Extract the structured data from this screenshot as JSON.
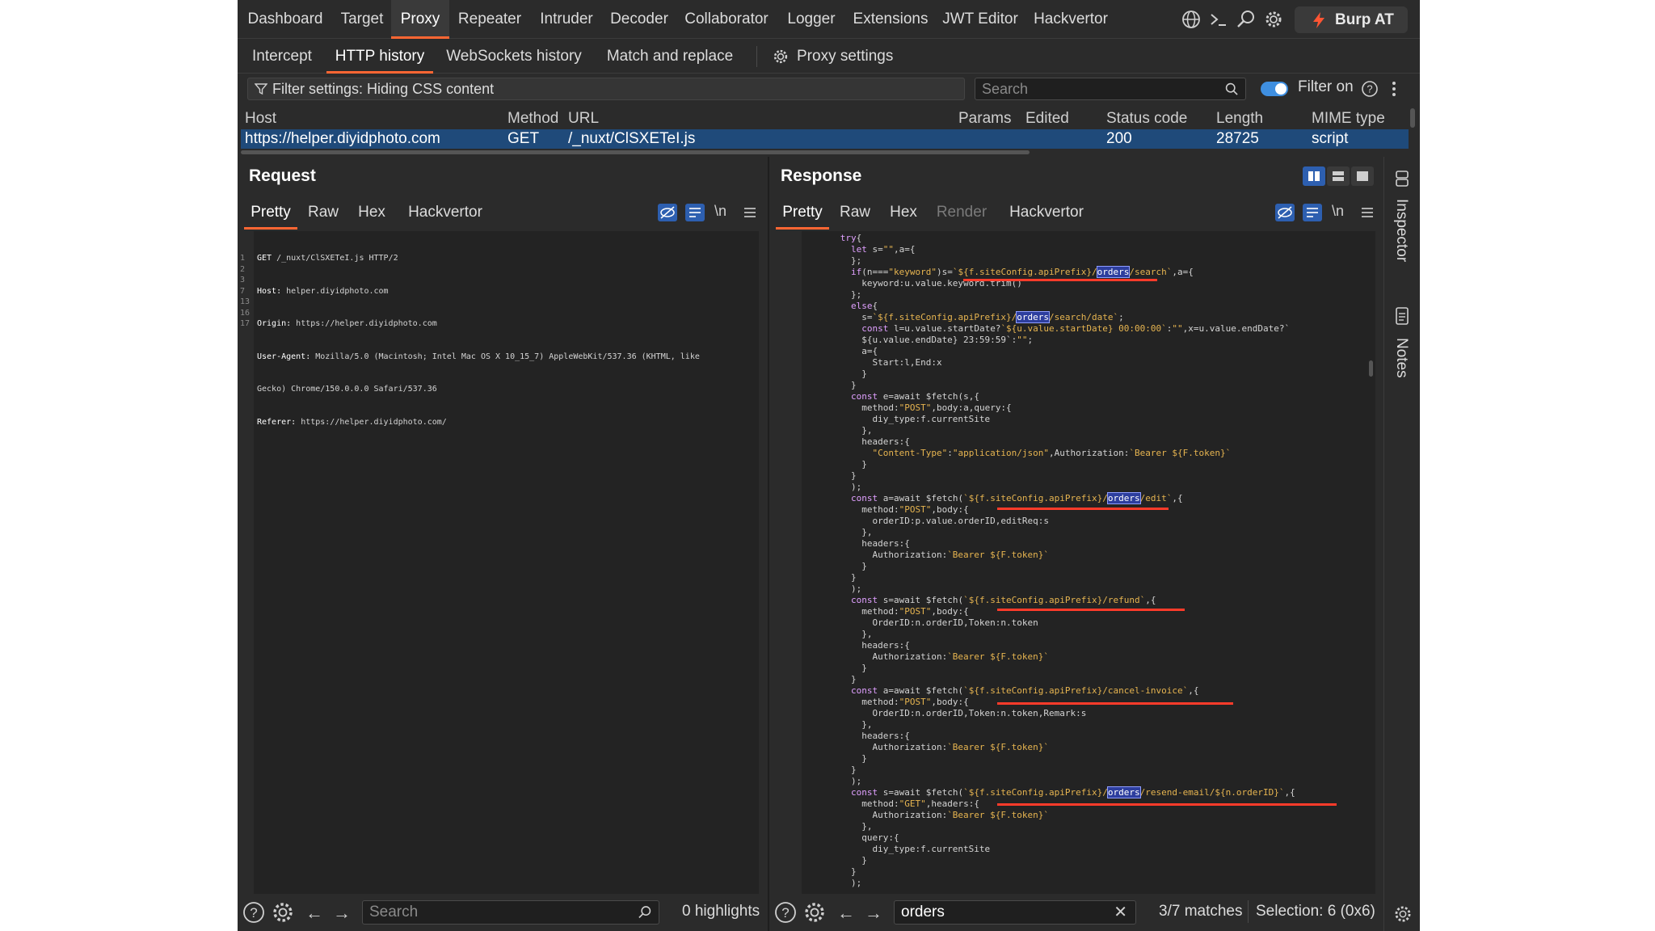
{
  "top_nav": {
    "tabs": [
      "Dashboard",
      "Target",
      "Proxy",
      "Repeater",
      "Intruder",
      "Decoder",
      "Collaborator",
      "Logger",
      "Extensions",
      "JWT Editor",
      "Hackvertor"
    ],
    "active": "Proxy",
    "burp_button": "Burp AT",
    "icons": [
      "globe-icon",
      "terminal-icon",
      "search-icon",
      "gear-icon"
    ]
  },
  "sub_nav": {
    "tabs": [
      "Intercept",
      "HTTP history",
      "WebSockets history",
      "Match and replace"
    ],
    "active": "HTTP history",
    "settings": "Proxy settings"
  },
  "filter": {
    "label": "Filter settings: Hiding CSS content",
    "search_placeholder": "Search",
    "toggle_label": "Filter on"
  },
  "history": {
    "columns": [
      "Host",
      "Method",
      "URL",
      "Params",
      "Edited",
      "Status code",
      "Length",
      "MIME type"
    ],
    "row": {
      "host": "https://helper.diyidphoto.com",
      "method": "GET",
      "url": "/_nuxt/ClSXETeI.js",
      "status": "200",
      "length": "28725",
      "mime": "script"
    }
  },
  "request": {
    "title": "Request",
    "tabs": [
      "Pretty",
      "Raw",
      "Hex",
      "Hackvertor"
    ],
    "active_tab": "Pretty",
    "line_numbers": [
      "1",
      "2",
      "3",
      "7",
      "",
      "13",
      "16",
      "17"
    ],
    "lines": [
      {
        "k": "GET ",
        "v": "/_nuxt/ClSXETeI.js HTTP/2"
      },
      {
        "k": "Host: ",
        "v": "helper.diyidphoto.com"
      },
      {
        "k": "Origin: ",
        "v": "https://helper.diyidphoto.com"
      },
      {
        "k": "User-Agent: ",
        "v": "Mozilla/5.0 (Macintosh; Intel Mac OS X 10_15_7) AppleWebKit/537.36 (KHTML, like"
      },
      {
        "k": "",
        "v": "Gecko) Chrome/150.0.0.0 Safari/537.36"
      },
      {
        "k": "Referer: ",
        "v": "https://helper.diyidphoto.com/"
      }
    ],
    "bottom": {
      "search_placeholder": "Search",
      "highlights": "0 highlights"
    }
  },
  "response": {
    "title": "Response",
    "tabs": [
      "Pretty",
      "Raw",
      "Hex",
      "Render",
      "Hackvertor"
    ],
    "active_tab": "Pretty",
    "code_lines": [
      "      try{",
      "        let s=\"\",a={",
      "        };",
      "        if(n===\"keyword\")s=`${f.siteConfig.apiPrefix}/orders/search`,a={",
      "          keyword:u.value.keyword.trim()",
      "        };",
      "        else{",
      "          s=`${f.siteConfig.apiPrefix}/orders/search/date`;",
      "          const l=u.value.startDate?`${u.value.startDate} 00:00:00`:\"\",x=u.value.endDate?`",
      "          ${u.value.endDate} 23:59:59`:\"\";",
      "          a={",
      "            Start:l,End:x",
      "          }",
      "        }",
      "        const e=await $fetch(s,{",
      "          method:\"POST\",body:a,query:{",
      "            diy_type:f.currentSite",
      "          },",
      "          headers:{",
      "            \"Content-Type\":\"application/json\",Authorization:`Bearer ${F.token}`",
      "          }",
      "        }",
      "        );",
      "        const a=await $fetch(`${f.siteConfig.apiPrefix}/orders/edit`,{",
      "          method:\"POST\",body:{",
      "            orderID:p.value.orderID,editReq:s",
      "          },",
      "          headers:{",
      "            Authorization:`Bearer ${F.token}`",
      "          }",
      "        }",
      "        );",
      "        const s=await $fetch(`${f.siteConfig.apiPrefix}/refund`,{",
      "          method:\"POST\",body:{",
      "            OrderID:n.orderID,Token:n.token",
      "          },",
      "          headers:{",
      "            Authorization:`Bearer ${F.token}`",
      "          }",
      "        }",
      "        const a=await $fetch(`${f.siteConfig.apiPrefix}/cancel-invoice`,{",
      "          method:\"POST\",body:{",
      "            OrderID:n.orderID,Token:n.token,Remark:s",
      "          },",
      "          headers:{",
      "            Authorization:`Bearer ${F.token}`",
      "          }",
      "        }",
      "        );",
      "        const s=await $fetch(`${f.siteConfig.apiPrefix}/orders/resend-email/${n.orderID}`,{",
      "          method:\"GET\",headers:{",
      "            Authorization:`Bearer ${F.token}`",
      "          },",
      "          query:{",
      "            diy_type:f.currentSite",
      "          }",
      "        }",
      "        );"
    ],
    "bottom": {
      "search_value": "orders",
      "matches": "3/7 matches",
      "selection": "Selection: 6 (0x6)"
    }
  },
  "sidebar": {
    "inspector": "Inspector",
    "notes": "Notes"
  },
  "colors": {
    "accent": "#ff6633",
    "selected_row": "#1f4a7a",
    "toggle": "#3f8fe0",
    "underline_red": "#ff3b2a",
    "highlight": "#2d3e9e"
  }
}
